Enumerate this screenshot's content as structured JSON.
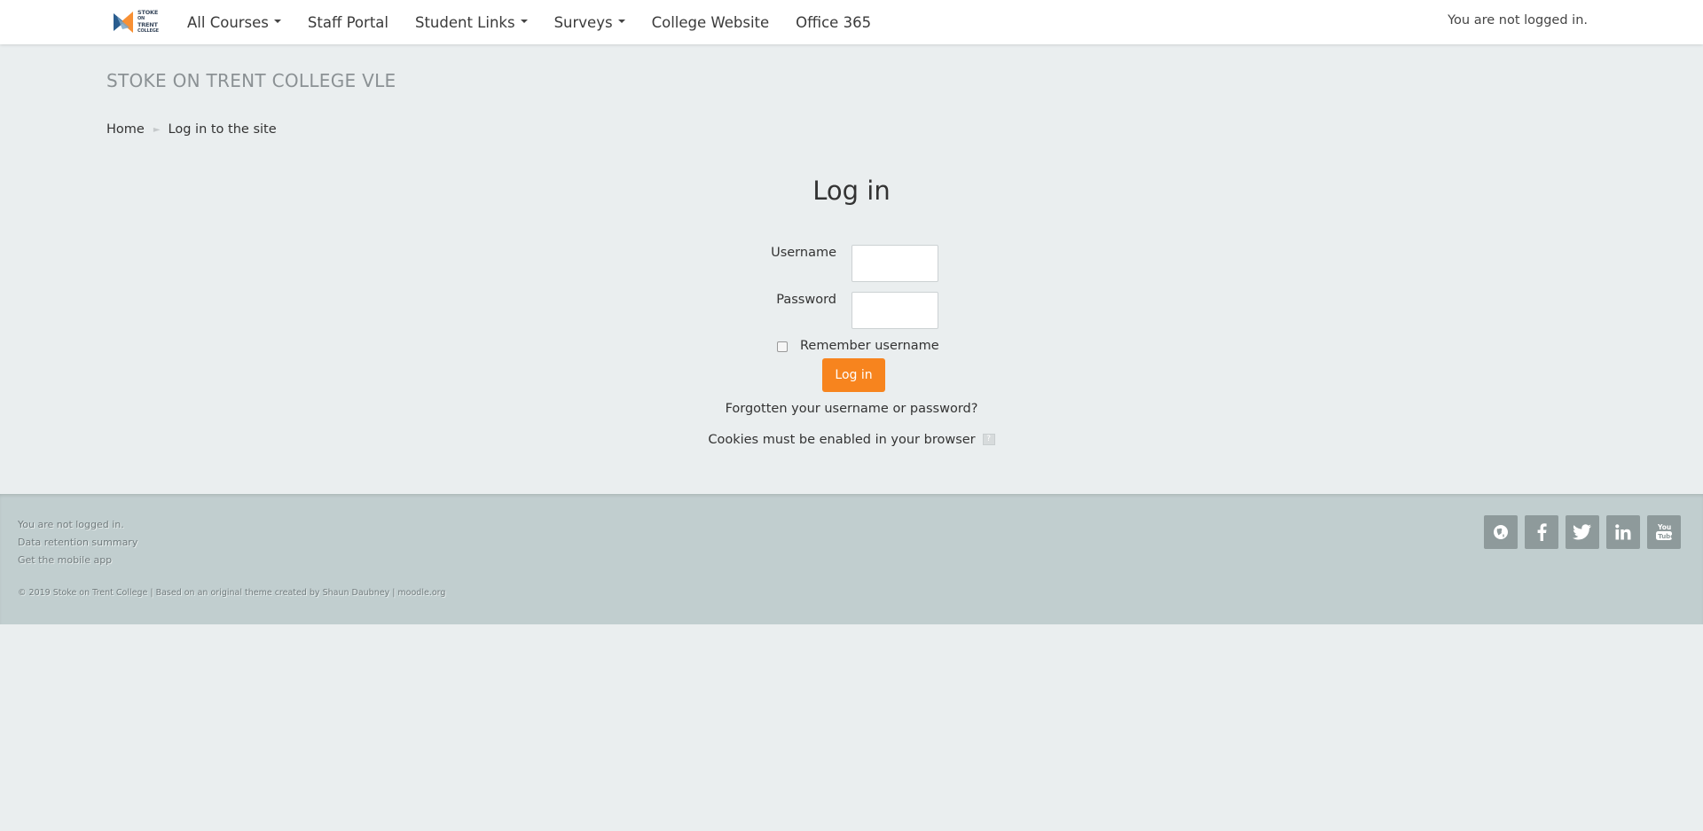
{
  "navbar": {
    "logo_lines": [
      "STOKE",
      "ON",
      "TRENT",
      "COLLEGE"
    ],
    "menu": [
      {
        "label": "All Courses",
        "dropdown": true
      },
      {
        "label": "Staff Portal",
        "dropdown": false
      },
      {
        "label": "Student Links",
        "dropdown": true
      },
      {
        "label": "Surveys",
        "dropdown": true
      },
      {
        "label": "College Website",
        "dropdown": false
      },
      {
        "label": "Office 365",
        "dropdown": false
      }
    ],
    "login_status": "You are not logged in."
  },
  "header": {
    "site_title": "STOKE ON TRENT COLLEGE VLE",
    "breadcrumb": {
      "home": "Home",
      "separator": "►",
      "current": "Log in to the site"
    }
  },
  "login": {
    "heading": "Log in",
    "username_label": "Username",
    "password_label": "Password",
    "username_value": "",
    "password_value": "",
    "remember_label": "Remember username",
    "remember_checked": false,
    "button_label": "Log in",
    "forgot_link": "Forgotten your username or password?",
    "cookies_text": "Cookies must be enabled in your browser",
    "help_icon": "?"
  },
  "footer": {
    "links": [
      "You are not logged in.",
      "Data retention summary",
      "Get the mobile app"
    ],
    "copyright": "© 2019 Stoke on Trent College | Based on an original theme created by Shaun Daubney | moodle.org",
    "social_icons": [
      "globe-icon",
      "facebook-icon",
      "twitter-icon",
      "linkedin-icon",
      "youtube-icon"
    ]
  },
  "colors": {
    "accent": "#f7841e",
    "background": "#eaeeef",
    "footer_bg": "#c1cecf",
    "social_bg": "#8e9a9b"
  }
}
